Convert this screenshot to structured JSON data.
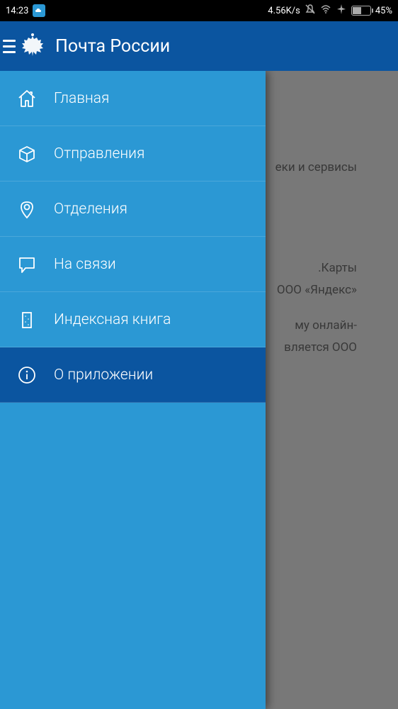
{
  "status": {
    "time": "14:23",
    "speed": "4.56K/s",
    "battery_pct": "45%"
  },
  "app": {
    "title": "Почта России"
  },
  "drawer": {
    "items": [
      {
        "label": "Главная",
        "icon": "home-icon"
      },
      {
        "label": "Отправления",
        "icon": "package-icon"
      },
      {
        "label": "Отделения",
        "icon": "location-icon"
      },
      {
        "label": "На связи",
        "icon": "chat-icon"
      },
      {
        "label": "Индексная книга",
        "icon": "book-icon"
      },
      {
        "label": "О приложении",
        "icon": "info-icon"
      }
    ],
    "active_index": 5
  },
  "background": {
    "lines": [
      "еки и сервисы",
      ".Карты",
      "ООО «Яндекс»",
      "му онлайн-",
      "вляется ООО"
    ]
  }
}
